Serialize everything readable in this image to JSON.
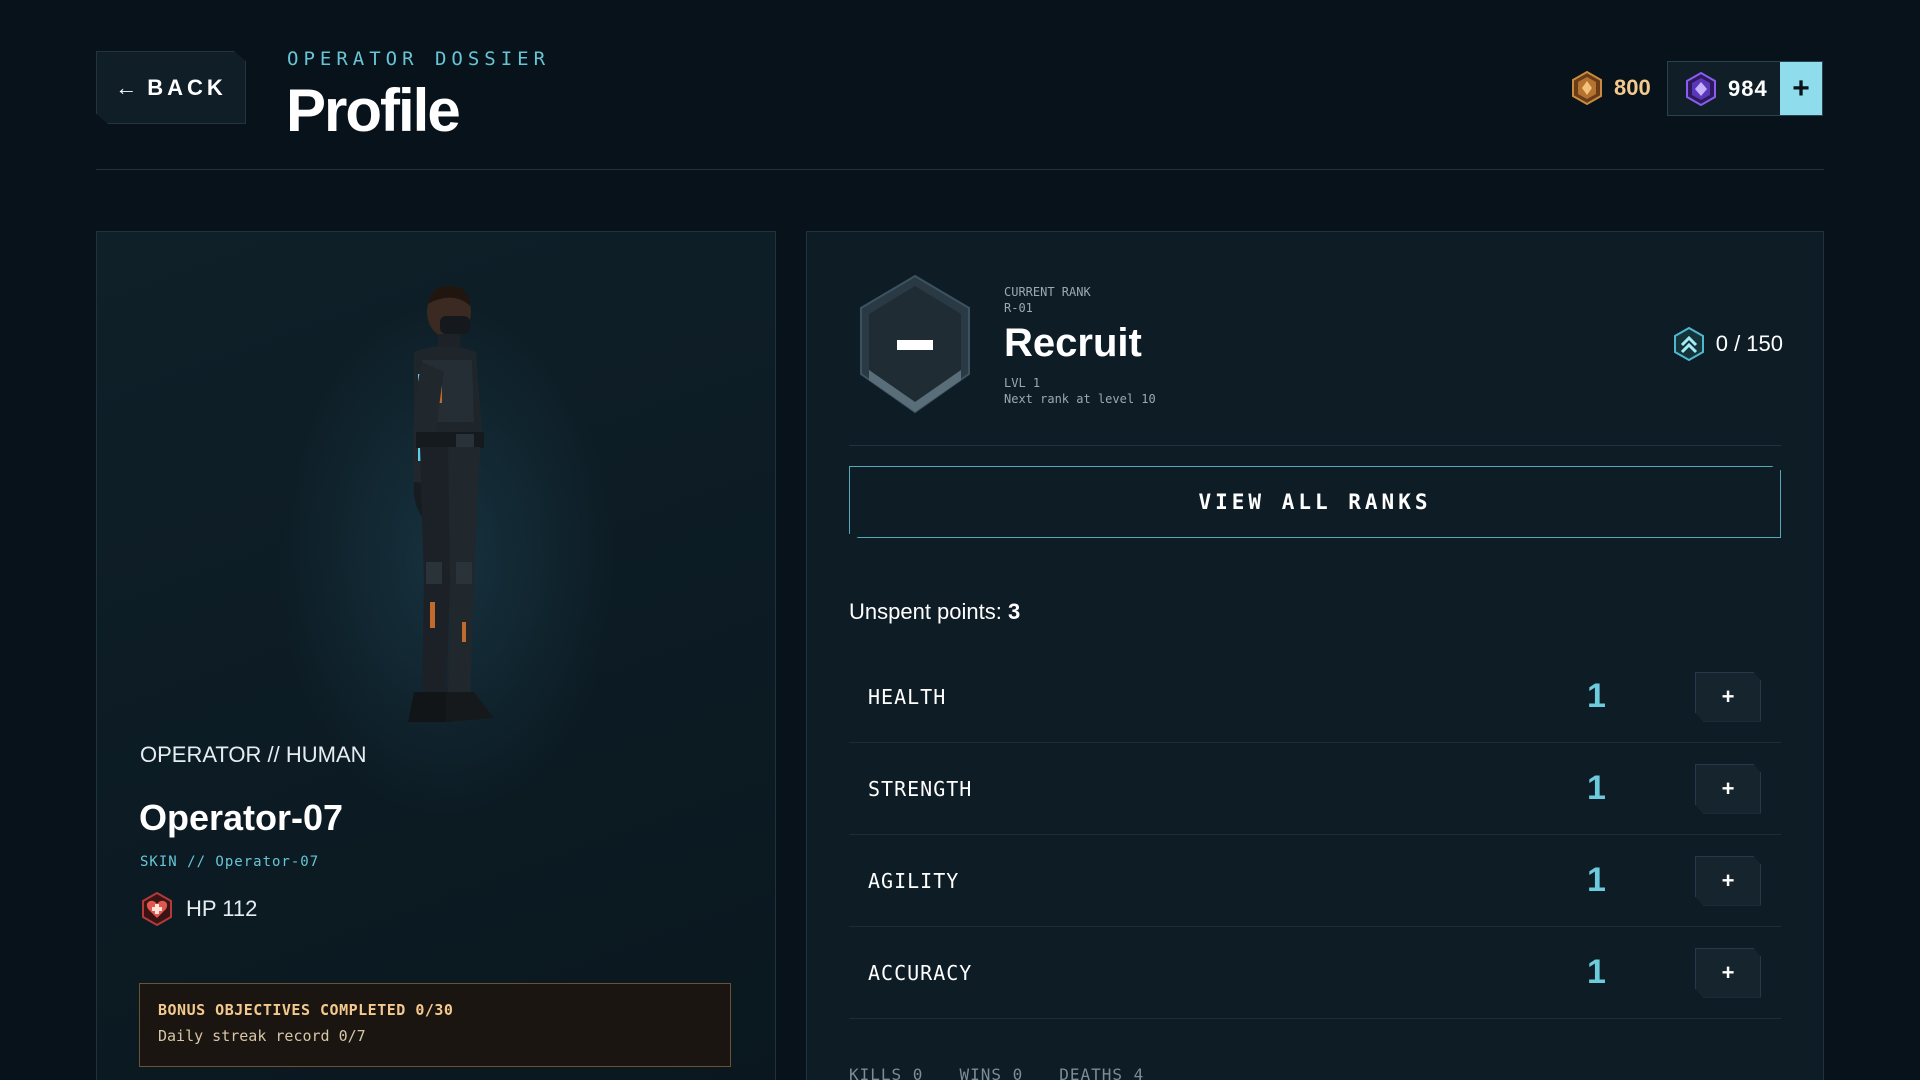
{
  "header": {
    "back_label": "BACK",
    "back_arrow": "←",
    "eyebrow": "OPERATOR DOSSIER",
    "title": "Profile",
    "gold_amount": "800",
    "gem_amount": "984",
    "add_label": "+"
  },
  "operator": {
    "class_label": "OPERATOR // HUMAN",
    "name": "Operator-07",
    "skin": "SKIN // Operator-07",
    "hp": "HP 112",
    "bonus_objectives": "BONUS OBJECTIVES COMPLETED 0/30",
    "daily_streak": "Daily streak record 0/7"
  },
  "rank": {
    "current_label": "CURRENT RANK",
    "code": "R-01",
    "name": "Recruit",
    "level": "LVL 1",
    "next_rank": "Next rank at level 10",
    "xp": "0 / 150",
    "view_all_label": "VIEW ALL RANKS"
  },
  "points": {
    "label": "Unspent points:",
    "value": "3"
  },
  "stats": [
    {
      "name": "HEALTH",
      "value": "1",
      "plus": "+"
    },
    {
      "name": "STRENGTH",
      "value": "1",
      "plus": "+"
    },
    {
      "name": "AGILITY",
      "value": "1",
      "plus": "+"
    },
    {
      "name": "ACCURACY",
      "value": "1",
      "plus": "+"
    }
  ],
  "record": {
    "kills": "KILLS 0",
    "wins": "WINS 0",
    "deaths": "DEATHS 4"
  },
  "colors": {
    "background": "#07121a",
    "accent_cyan": "#66c6d6",
    "stat_value": "#6ccbdc",
    "gold": "#f4c98e",
    "gem": "#8a5cf0"
  },
  "icons": {
    "gold": "gold-coin-icon",
    "gem": "gem-icon",
    "hp": "heart-icon",
    "rank": "rank-shield-icon",
    "xp": "xp-chevron-icon"
  }
}
